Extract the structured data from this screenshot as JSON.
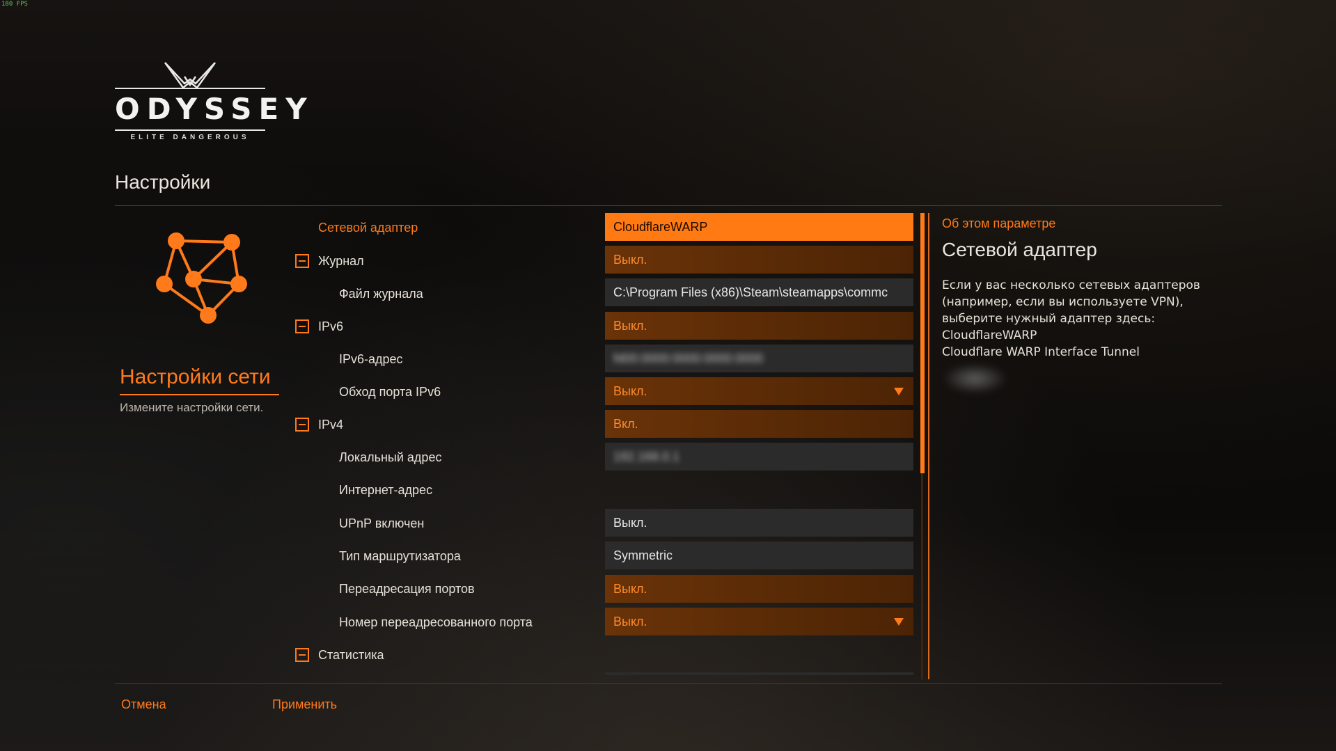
{
  "fps": "180 FPS",
  "logo": {
    "word": "ODYSSEY",
    "sub": "ELITE DANGEROUS"
  },
  "page_title": "Настройки",
  "section": {
    "title": "Настройки сети",
    "description": "Измените настройки сети."
  },
  "rows": [
    {
      "label": "Сетевой адаптер",
      "value": "CloudflareWARP"
    },
    {
      "label": "Журнал",
      "value": "Выкл."
    },
    {
      "label": "Файл журнала",
      "value": "C:\\Program Files (x86)\\Steam\\steamapps\\commc"
    },
    {
      "label": "IPv6",
      "value": "Выкл."
    },
    {
      "label": "IPv6-адрес",
      "value": "fd00:0000:0000:0000:0000"
    },
    {
      "label": "Обход порта IPv6",
      "value": "Выкл."
    },
    {
      "label": "IPv4",
      "value": "Вкл."
    },
    {
      "label": "Локальный адрес",
      "value": "192.168.0.1"
    },
    {
      "label": "Интернет-адрес",
      "value": ""
    },
    {
      "label": "UPnP включен",
      "value": "Выкл."
    },
    {
      "label": "Тип маршрутизатора",
      "value": "Symmetric"
    },
    {
      "label": "Переадресация портов",
      "value": "Выкл."
    },
    {
      "label": "Номер переадресованного порта",
      "value": "Выкл."
    },
    {
      "label": "Статистика",
      "value": ""
    }
  ],
  "info": {
    "label": "Об этом параметре",
    "title": "Сетевой адаптер",
    "lines": [
      "Если у вас несколько сетевых адаптеров",
      "(например, если вы используете VPN),",
      "выберите нужный адаптер здесь:",
      "CloudflareWARP",
      "Cloudflare WARP Interface Tunnel"
    ]
  },
  "buttons": {
    "cancel": "Отмена",
    "apply": "Применить"
  },
  "colors": {
    "accent": "#ff7a1a",
    "field_orange": "#5a2b06",
    "field_grey": "#2c2b2b"
  }
}
